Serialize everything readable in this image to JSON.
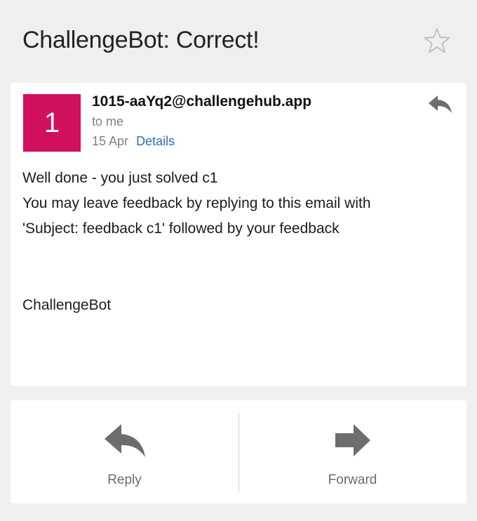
{
  "subject": "ChallengeBot: Correct!",
  "message": {
    "avatar_letter": "1",
    "sender": "1015-aaYq2@challengehub.app",
    "recipient": "to me",
    "date": "15 Apr",
    "details_label": "Details",
    "body_lines": [
      "Well done - you just solved c1",
      "You may leave feedback by replying to this email with",
      "'Subject: feedback c1' followed by your feedback"
    ],
    "signature": "ChallengeBot"
  },
  "actions": {
    "reply_label": "Reply",
    "forward_label": "Forward"
  },
  "colors": {
    "background": "#efefef",
    "card": "#ffffff",
    "avatar": "#d0105f",
    "link": "#2f6fb5",
    "icon": "#6d6d6d",
    "star": "#b8b8b8"
  },
  "icons": {
    "star": "star-outline-icon",
    "reply_small": "reply-arrow-icon",
    "reply": "reply-arrow-icon",
    "forward": "forward-arrow-icon"
  }
}
